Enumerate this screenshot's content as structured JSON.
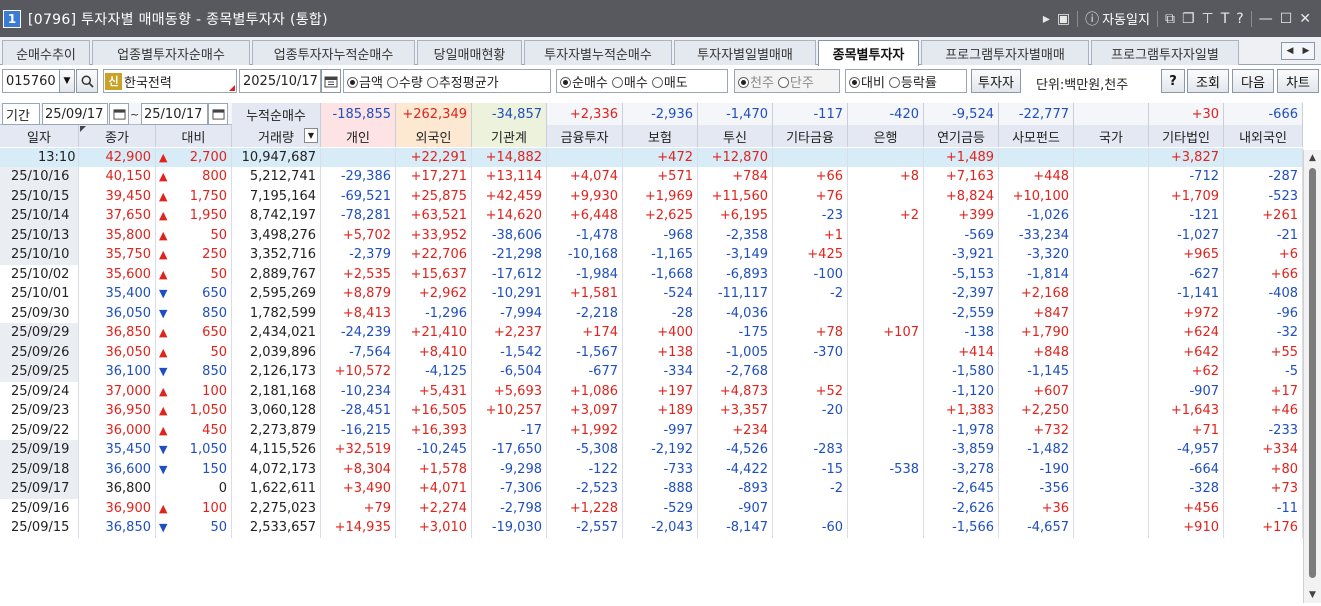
{
  "window": {
    "number": "1",
    "title": "[0796] 투자자별 매매동향 - 종목별투자자 (통합)",
    "auto_label": "자동일지"
  },
  "tabs": [
    "순매수추이",
    "업종별투자자순매수",
    "업종투자자누적순매수",
    "당일매매현황",
    "투자자별누적순매수",
    "투자자별일별매매",
    "종목별투자자",
    "프로그램투자자별매매",
    "프로그램투자자일별"
  ],
  "active_tab": 6,
  "controls": {
    "code": "015760",
    "badge": "신",
    "stock_name": "한국전력",
    "date": "2025/10/17",
    "r_amount": "금액",
    "r_qty": "수량",
    "r_avg": "추정평균가",
    "r_net": "순매수",
    "r_buy": "매수",
    "r_sell": "매도",
    "r_thousand": "천주",
    "r_unit_share": "단주",
    "r_vs": "대비",
    "r_rate": "등락률",
    "investor_btn": "투자자",
    "unit_text": "단위:백만원,천주",
    "help_btn": "?",
    "query_btn": "조회",
    "next_btn": "다음",
    "chart_btn": "차트"
  },
  "period": {
    "label": "기간",
    "from": "25/09/17",
    "to": "25/10/17",
    "cum_label": "누적순매수"
  },
  "cumulative": [
    "-185,855",
    "+262,349",
    "-34,857",
    "+2,336",
    "-2,936",
    "-1,470",
    "-117",
    "-420",
    "-9,524",
    "-22,777",
    "",
    "+30",
    "-666"
  ],
  "columns": [
    "일자",
    "종가",
    "대비",
    "거래량",
    "개인",
    "외국인",
    "기관계",
    "금융투자",
    "보험",
    "투신",
    "기타금융",
    "은행",
    "연기금등",
    "사모펀드",
    "국가",
    "기타법인",
    "내외국인"
  ],
  "rows": [
    {
      "date": "13:10",
      "close": "42,900",
      "dir": "up",
      "chg": "2,700",
      "vol": "10,947,687",
      "v": [
        "",
        "+22,291",
        "+14,882",
        "",
        "+472",
        "+12,870",
        "",
        "",
        "+1,489",
        "",
        "",
        "+3,827",
        ""
      ]
    },
    {
      "date": "25/10/16",
      "close": "40,150",
      "dir": "up",
      "chg": "800",
      "vol": "5,212,741",
      "v": [
        "-29,386",
        "+17,271",
        "+13,114",
        "+4,074",
        "+571",
        "+784",
        "+66",
        "+8",
        "+7,163",
        "+448",
        "",
        "-712",
        "-287"
      ]
    },
    {
      "date": "25/10/15",
      "close": "39,450",
      "dir": "up",
      "chg": "1,750",
      "vol": "7,195,164",
      "v": [
        "-69,521",
        "+25,875",
        "+42,459",
        "+9,930",
        "+1,969",
        "+11,560",
        "+76",
        "",
        "+8,824",
        "+10,100",
        "",
        "+1,709",
        "-523"
      ]
    },
    {
      "date": "25/10/14",
      "close": "37,650",
      "dir": "up",
      "chg": "1,950",
      "vol": "8,742,197",
      "v": [
        "-78,281",
        "+63,521",
        "+14,620",
        "+6,448",
        "+2,625",
        "+6,195",
        "-23",
        "+2",
        "+399",
        "-1,026",
        "",
        "-121",
        "+261"
      ]
    },
    {
      "date": "25/10/13",
      "close": "35,800",
      "dir": "up",
      "chg": "50",
      "vol": "3,498,276",
      "v": [
        "+5,702",
        "+33,952",
        "-38,606",
        "-1,478",
        "-968",
        "-2,358",
        "+1",
        "",
        "-569",
        "-33,234",
        "",
        "-1,027",
        "-21"
      ]
    },
    {
      "date": "25/10/10",
      "close": "35,750",
      "dir": "up",
      "chg": "250",
      "vol": "3,352,716",
      "v": [
        "-2,379",
        "+22,706",
        "-21,298",
        "-10,168",
        "-1,165",
        "-3,149",
        "+425",
        "",
        "-3,921",
        "-3,320",
        "",
        "+965",
        "+6"
      ]
    },
    {
      "date": "25/10/02",
      "close": "35,600",
      "dir": "up",
      "chg": "50",
      "vol": "2,889,767",
      "v": [
        "+2,535",
        "+15,637",
        "-17,612",
        "-1,984",
        "-1,668",
        "-6,893",
        "-100",
        "",
        "-5,153",
        "-1,814",
        "",
        "-627",
        "+66"
      ]
    },
    {
      "date": "25/10/01",
      "close": "35,400",
      "dir": "down",
      "chg": "650",
      "vol": "2,595,269",
      "v": [
        "+8,879",
        "+2,962",
        "-10,291",
        "+1,581",
        "-524",
        "-11,117",
        "-2",
        "",
        "-2,397",
        "+2,168",
        "",
        "-1,141",
        "-408"
      ]
    },
    {
      "date": "25/09/30",
      "close": "36,050",
      "dir": "down",
      "chg": "850",
      "vol": "1,782,599",
      "v": [
        "+8,413",
        "-1,296",
        "-7,994",
        "-2,218",
        "-28",
        "-4,036",
        "",
        "",
        "-2,559",
        "+847",
        "",
        "+972",
        "-96"
      ]
    },
    {
      "date": "25/09/29",
      "close": "36,850",
      "dir": "up",
      "chg": "650",
      "vol": "2,434,021",
      "v": [
        "-24,239",
        "+21,410",
        "+2,237",
        "+174",
        "+400",
        "-175",
        "+78",
        "+107",
        "-138",
        "+1,790",
        "",
        "+624",
        "-32"
      ]
    },
    {
      "date": "25/09/26",
      "close": "36,050",
      "dir": "up",
      "chg": "50",
      "vol": "2,039,896",
      "v": [
        "-7,564",
        "+8,410",
        "-1,542",
        "-1,567",
        "+138",
        "-1,005",
        "-370",
        "",
        "+414",
        "+848",
        "",
        "+642",
        "+55"
      ]
    },
    {
      "date": "25/09/25",
      "close": "36,100",
      "dir": "down",
      "chg": "850",
      "vol": "2,126,173",
      "v": [
        "+10,572",
        "-4,125",
        "-6,504",
        "-677",
        "-334",
        "-2,768",
        "",
        "",
        "-1,580",
        "-1,145",
        "",
        "+62",
        "-5"
      ]
    },
    {
      "date": "25/09/24",
      "close": "37,000",
      "dir": "up",
      "chg": "100",
      "vol": "2,181,168",
      "v": [
        "-10,234",
        "+5,431",
        "+5,693",
        "+1,086",
        "+197",
        "+4,873",
        "+52",
        "",
        "-1,120",
        "+607",
        "",
        "-907",
        "+17"
      ]
    },
    {
      "date": "25/09/23",
      "close": "36,950",
      "dir": "up",
      "chg": "1,050",
      "vol": "3,060,128",
      "v": [
        "-28,451",
        "+16,505",
        "+10,257",
        "+3,097",
        "+189",
        "+3,357",
        "-20",
        "",
        "+1,383",
        "+2,250",
        "",
        "+1,643",
        "+46"
      ]
    },
    {
      "date": "25/09/22",
      "close": "36,000",
      "dir": "up",
      "chg": "450",
      "vol": "2,273,879",
      "v": [
        "-16,215",
        "+16,393",
        "-17",
        "+1,992",
        "-997",
        "+234",
        "",
        "",
        "-1,978",
        "+732",
        "",
        "+71",
        "-233"
      ]
    },
    {
      "date": "25/09/19",
      "close": "35,450",
      "dir": "down",
      "chg": "1,050",
      "vol": "4,115,526",
      "v": [
        "+32,519",
        "-10,245",
        "-17,650",
        "-5,308",
        "-2,192",
        "-4,526",
        "-283",
        "",
        "-3,859",
        "-1,482",
        "",
        "-4,957",
        "+334"
      ]
    },
    {
      "date": "25/09/18",
      "close": "36,600",
      "dir": "down",
      "chg": "150",
      "vol": "4,072,173",
      "v": [
        "+8,304",
        "+1,578",
        "-9,298",
        "-122",
        "-733",
        "-4,422",
        "-15",
        "-538",
        "-3,278",
        "-190",
        "",
        "-664",
        "+80"
      ]
    },
    {
      "date": "25/09/17",
      "close": "36,800",
      "dir": "flat",
      "chg": "0",
      "vol": "1,622,611",
      "v": [
        "+3,490",
        "+4,071",
        "-7,306",
        "-2,523",
        "-888",
        "-893",
        "-2",
        "",
        "-2,645",
        "-356",
        "",
        "-328",
        "+73"
      ]
    },
    {
      "date": "25/09/16",
      "close": "36,900",
      "dir": "up",
      "chg": "100",
      "vol": "2,275,023",
      "v": [
        "+79",
        "+2,274",
        "-2,798",
        "+1,228",
        "-529",
        "-907",
        "",
        "",
        "-2,626",
        "+36",
        "",
        "+456",
        "-11"
      ]
    },
    {
      "date": "25/09/15",
      "close": "36,850",
      "dir": "down",
      "chg": "50",
      "vol": "2,533,657",
      "v": [
        "+14,935",
        "+3,010",
        "-19,030",
        "-2,557",
        "-2,043",
        "-8,147",
        "-60",
        "",
        "-1,566",
        "-4,657",
        "",
        "+910",
        "+176"
      ]
    }
  ],
  "colors": {
    "up": "#e0231c",
    "down": "#1f4fbf",
    "flat": "#222222",
    "today_bg": "#d8ecf7",
    "group_bg": "#eaedf2",
    "header_bg": "#e3e8f2",
    "ind_bg": "#fde3e3",
    "for_bg": "#fde9d2",
    "inst_bg": "#edf2dc"
  }
}
